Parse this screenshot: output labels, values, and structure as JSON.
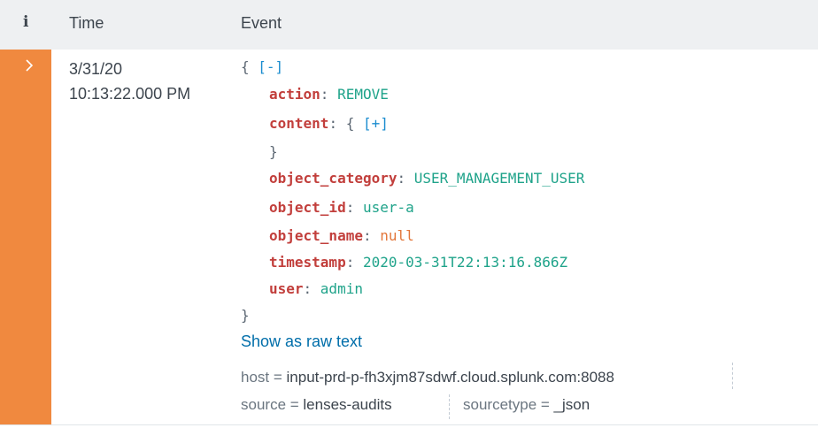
{
  "header": {
    "info_icon_glyph": "i",
    "time_label": "Time",
    "event_label": "Event"
  },
  "event": {
    "date": "3/31/20",
    "time": "10:13:22.000 PM",
    "open_brace": "{",
    "collapse_toggle": "[-]",
    "expand_toggle": "[+]",
    "close_brace": "}",
    "fields": {
      "action": {
        "key": "action",
        "value": "REMOVE"
      },
      "content": {
        "key": "content"
      },
      "object_category": {
        "key": "object_category",
        "value": "USER_MANAGEMENT_USER"
      },
      "object_id": {
        "key": "object_id",
        "value": "user-a"
      },
      "object_name": {
        "key": "object_name",
        "value": "null"
      },
      "timestamp": {
        "key": "timestamp",
        "value": "2020-03-31T22:13:16.866Z"
      },
      "user": {
        "key": "user",
        "value": "admin"
      }
    },
    "raw_link": "Show as raw text",
    "metadata": {
      "host": {
        "key": "host",
        "value": "input-prd-p-fh3xjm87sdwf.cloud.splunk.com:8088"
      },
      "source": {
        "key": "source",
        "value": "lenses-audits"
      },
      "sourcetype": {
        "key": "sourcetype",
        "value": "_json"
      }
    }
  },
  "colors": {
    "accent": "#f0893f",
    "key": "#c23f3c",
    "string": "#1fa38a",
    "null": "#e3763a",
    "link": "#006eaa"
  }
}
